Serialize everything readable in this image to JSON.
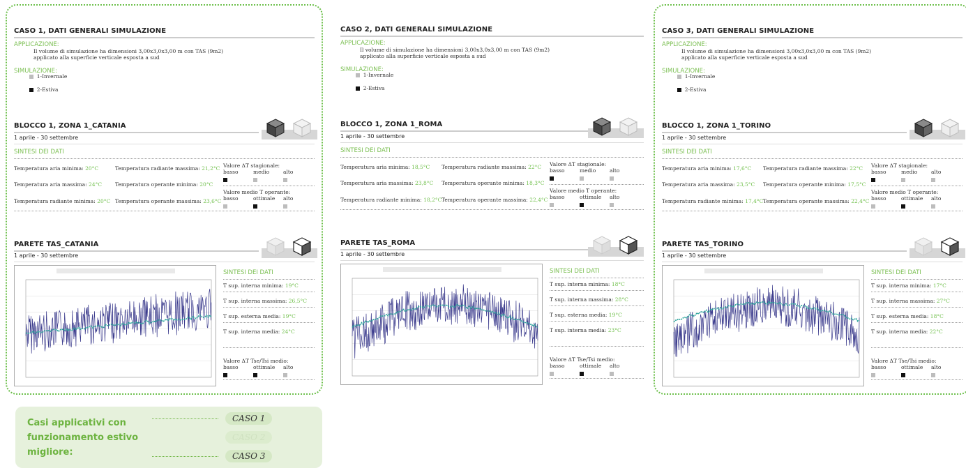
{
  "panels": [
    {
      "title": "CASO 1, DATI GENERALI SIMULAZIONE",
      "applicazione_label": "APPLICAZIONE:",
      "applicazione_text": "Il volume di simulazione ha dimensioni 3,00x3,0x3,00 m con TAS (9m2) applicato alla superficie verticale esposta a sud",
      "simulazione_label": "SIMULAZIONE:",
      "sim_option_1": "1-Invernale",
      "sim_option_2": "2-Estiva",
      "blocco_title": "BLOCCO 1, ZONA 1_CATANIA",
      "period": "1 aprile - 30 settembre",
      "sintesi_label": "SINTESI DEI DATI",
      "t_aria_min_label": "Temperatura aria minima:",
      "t_aria_min": "20°C",
      "t_aria_max_label": "Temperatura aria massima:",
      "t_aria_max": "24°C",
      "t_rad_min_label": "Temperatura radiante minima:",
      "t_rad_min": "20°C",
      "t_rad_max_label": "Temperatura radiante massima:",
      "t_rad_max": "21,2°C",
      "t_op_min_label": "Temperatura operante minima:",
      "t_op_min": "20°C",
      "t_op_max_label": "Temperatura operante massima:",
      "t_op_max": "23,6°C",
      "dt_stag_label": "Valore ΔT stagionale:",
      "t_op_medio_label": "Valore medio T operante:",
      "parete_title": "PARETE TAS_CATANIA",
      "parete_period": "1 aprile - 30 settembre",
      "sint2_label": "SINTESI DEI DATI",
      "tsup_int_min_label": "T sup. interna minima:",
      "tsup_int_min": "19°C",
      "tsup_int_max_label": "T sup. interna massima:",
      "tsup_int_max": "26,5°C",
      "tsup_est_med_label": "T sup. esterna media:",
      "tsup_est_med": "19°C",
      "tsup_int_med_label": "T sup. interna media:",
      "tsup_int_med": "24°C",
      "dt_tse_label": "Valore ΔT Tse/Tsi medio:",
      "framed": true
    },
    {
      "title": "CASO 2, DATI GENERALI SIMULAZIONE",
      "applicazione_label": "APPLICAZIONE:",
      "applicazione_text": "Il volume di simulazione ha dimensioni 3,00x3,0x3,00 m con TAS (9m2) applicato alla superficie verticale esposta a sud",
      "simulazione_label": "SIMULAZIONE:",
      "sim_option_1": "1-Invernale",
      "sim_option_2": "2-Estiva",
      "blocco_title": "BLOCCO 1, ZONA 1_ROMA",
      "period": "1 aprile - 30 settembre",
      "sintesi_label": "SINTESI DEI DATI",
      "t_aria_min_label": "Temperatura aria minima:",
      "t_aria_min": "18,5°C",
      "t_aria_max_label": "Temperatura aria massima:",
      "t_aria_max": "23,8°C",
      "t_rad_min_label": "Temperatura radiante minima:",
      "t_rad_min": "18,2°C",
      "t_rad_max_label": "Temperatura radiante massima:",
      "t_rad_max": "22°C",
      "t_op_min_label": "Temperatura operante minima:",
      "t_op_min": "18,3°C",
      "t_op_max_label": "Temperatura operante massima:",
      "t_op_max": "22,4°C",
      "dt_stag_label": "Valore ΔT stagionale:",
      "t_op_medio_label": "Valore medio T operante:",
      "parete_title": "PARETE TAS_ROMA",
      "parete_period": "1 aprile - 30 settembre",
      "sint2_label": "SINTESI DEI DATI",
      "tsup_int_min_label": "T sup. interna minima:",
      "tsup_int_min": "18°C",
      "tsup_int_max_label": "T sup. interna massima:",
      "tsup_int_max": "28°C",
      "tsup_est_med_label": "T sup. esterna media:",
      "tsup_est_med": "19°C",
      "tsup_int_med_label": "T sup. interna media:",
      "tsup_int_med": "23°C",
      "dt_tse_label": "Valore ΔT Tse/Tsi medio:",
      "framed": false
    },
    {
      "title": "CASO 3, DATI GENERALI SIMULAZIONE",
      "applicazione_label": "APPLICAZIONE:",
      "applicazione_text": "Il volume di simulazione ha dimensioni 3,00x3,0x3,00 m con TAS (9m2) applicato alla superficie verticale esposta a sud",
      "simulazione_label": "SIMULAZIONE:",
      "sim_option_1": "1-Invernale",
      "sim_option_2": "2-Estiva",
      "blocco_title": "BLOCCO 1, ZONA 1_TORINO",
      "period": "1 aprile - 30 settembre",
      "sintesi_label": "SINTESI DEI DATI",
      "t_aria_min_label": "Temperatura aria minima:",
      "t_aria_min": "17,6°C",
      "t_aria_max_label": "Temperatura aria massima:",
      "t_aria_max": "23,5°C",
      "t_rad_min_label": "Temperatura radiante minima:",
      "t_rad_min": "17,4°C",
      "t_rad_max_label": "Temperatura radiante massima:",
      "t_rad_max": "22°C",
      "t_op_min_label": "Temperatura operante minima:",
      "t_op_min": "17,5°C",
      "t_op_max_label": "Temperatura operante massima:",
      "t_op_max": "22,4°C",
      "dt_stag_label": "Valore ΔT stagionale:",
      "t_op_medio_label": "Valore medio T operante:",
      "parete_title": "PARETE TAS_TORINO",
      "parete_period": "1 aprile - 30 settembre",
      "sint2_label": "SINTESI DEI DATI",
      "tsup_int_min_label": "T sup. interna minima:",
      "tsup_int_min": "17°C",
      "tsup_int_max_label": "T sup. interna massima:",
      "tsup_int_max": "27°C",
      "tsup_est_med_label": "T sup. esterna media:",
      "tsup_est_med": "18°C",
      "tsup_int_med_label": "T sup. interna media:",
      "tsup_int_med": "22°C",
      "dt_tse_label": "Valore ΔT Tse/Tsi medio:",
      "framed": true
    }
  ],
  "scale_labels": {
    "basso": "basso",
    "medio": "medio",
    "alto": "alto",
    "ottimale": "ottimale"
  },
  "legend": {
    "title_line1": "Casi applicativi con",
    "title_line2": "funzionamento estivo",
    "title_line3": "migliore:",
    "item1": "CASO 1",
    "item2": "CASO 2",
    "item3": "CASO 3"
  },
  "colors": {
    "accent_green": "#6cbf4a",
    "chart_line": "#3a3a8c",
    "chart_mean": "#2aa39a"
  }
}
